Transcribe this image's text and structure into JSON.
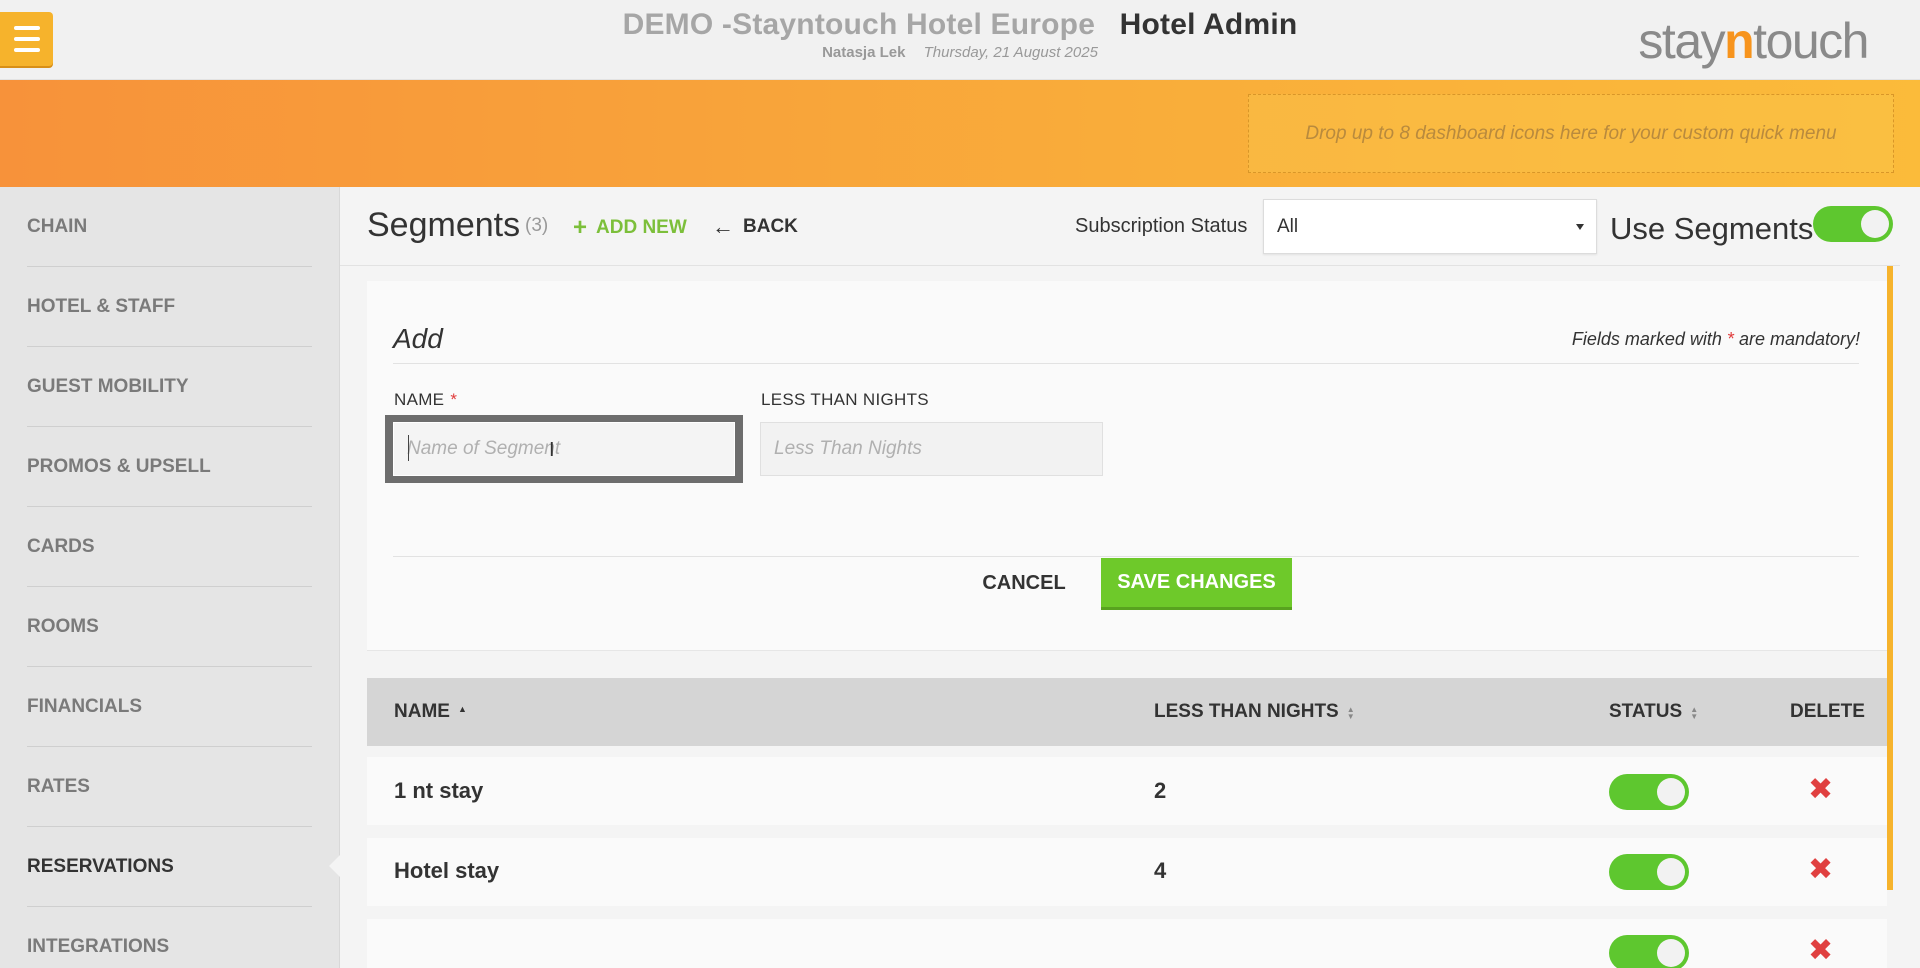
{
  "header": {
    "hotel_name": "DEMO -Stayntouch Hotel Europe",
    "app_name": "Hotel Admin",
    "user": "Natasja Lek",
    "date": "Thursday, 21 August 2025",
    "logo_prefix": "stay",
    "logo_n": "n",
    "logo_suffix": "touch"
  },
  "quick_menu": {
    "drop_text": "Drop up to 8 dashboard icons here for your custom quick menu"
  },
  "sidebar": {
    "items": [
      {
        "label": "CHAIN"
      },
      {
        "label": "HOTEL & STAFF"
      },
      {
        "label": "GUEST MOBILITY"
      },
      {
        "label": "PROMOS & UPSELL"
      },
      {
        "label": "CARDS"
      },
      {
        "label": "ROOMS"
      },
      {
        "label": "FINANCIALS"
      },
      {
        "label": "RATES"
      },
      {
        "label": "RESERVATIONS",
        "active": true
      },
      {
        "label": "INTEGRATIONS"
      }
    ]
  },
  "page": {
    "title": "Segments",
    "count": "(3)",
    "add_new": "ADD NEW",
    "back": "BACK",
    "subscription_label": "Subscription Status",
    "subscription_value": "All",
    "use_segments_label": "Use Segments",
    "use_segments_on": true
  },
  "form": {
    "title": "Add",
    "mandatory_prefix": "Fields marked with ",
    "mandatory_star": "*",
    "mandatory_suffix": " are mandatory!",
    "name_label": "NAME",
    "name_required": "*",
    "name_placeholder": "Name of Segment",
    "name_value": "",
    "nights_label": "LESS THAN NIGHTS",
    "nights_placeholder": "Less Than Nights",
    "nights_value": "",
    "cancel": "CANCEL",
    "save": "SAVE CHANGES"
  },
  "table": {
    "columns": {
      "name": "NAME",
      "nights": "LESS THAN NIGHTS",
      "status": "STATUS",
      "delete": "DELETE"
    },
    "rows": [
      {
        "name": "1 nt stay",
        "nights": "2",
        "status": true
      },
      {
        "name": "Hotel stay",
        "nights": "4",
        "status": true
      }
    ]
  },
  "colors": {
    "accent_orange": "#f7941d",
    "menu_yellow": "#f6b32c",
    "toggle_green": "#5ec72f",
    "save_green": "#6ec92a",
    "delete_red": "#e04040"
  }
}
